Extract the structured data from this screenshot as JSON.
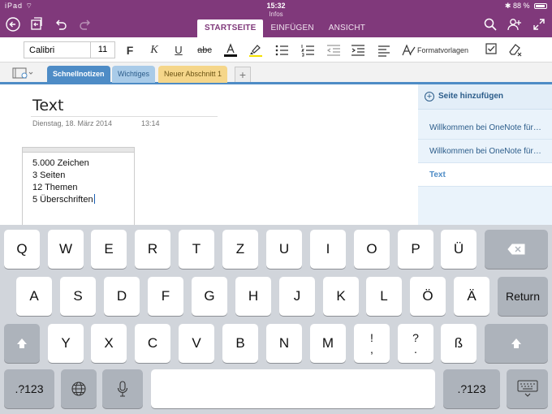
{
  "status": {
    "left": "iPad ⌔",
    "time": "15:32",
    "sub": "Infos",
    "battery": "88 %"
  },
  "ribbon": {
    "tabs": [
      {
        "label": "STARTSEITE",
        "active": true
      },
      {
        "label": "EINFÜGEN",
        "active": false
      },
      {
        "label": "ANSICHT",
        "active": false
      }
    ]
  },
  "toolbar": {
    "font_name": "Calibri",
    "font_size": "11",
    "styles_label": "Formatvorlagen"
  },
  "sections": [
    {
      "label": "Schnellnotizen",
      "color": "#4e8cc6",
      "active": true
    },
    {
      "label": "Wichtiges",
      "color": "#a9cbe8",
      "active": false
    },
    {
      "label": "Neuer Abschnitt 1",
      "color": "#f5d68a",
      "active": false
    }
  ],
  "page": {
    "title": "Text",
    "date": "Dienstag, 18. März 2014",
    "time": "13:14",
    "note_lines": [
      "5.000 Zeichen",
      "3 Seiten",
      "12 Themen",
      "5 Überschriften"
    ]
  },
  "pagelist": {
    "add_label": "Seite hinzufügen",
    "items": [
      {
        "label": "Willkommen bei OneNote für…",
        "active": false
      },
      {
        "label": "Willkommen bei OneNote für…",
        "active": false
      },
      {
        "label": "Text",
        "active": true
      }
    ]
  },
  "keyboard": {
    "row1": [
      "Q",
      "W",
      "E",
      "R",
      "T",
      "Z",
      "U",
      "I",
      "O",
      "P",
      "Ü"
    ],
    "row2": [
      "A",
      "S",
      "D",
      "F",
      "G",
      "H",
      "J",
      "K",
      "L",
      "Ö",
      "Ä"
    ],
    "row3": [
      "Y",
      "X",
      "C",
      "V",
      "B",
      "N",
      "M"
    ],
    "return_label": "Return",
    "num_label": ".?123",
    "punct1": {
      "top": "!",
      "bottom": ","
    },
    "punct2": {
      "top": "?",
      "bottom": "."
    },
    "sz": "ß"
  }
}
